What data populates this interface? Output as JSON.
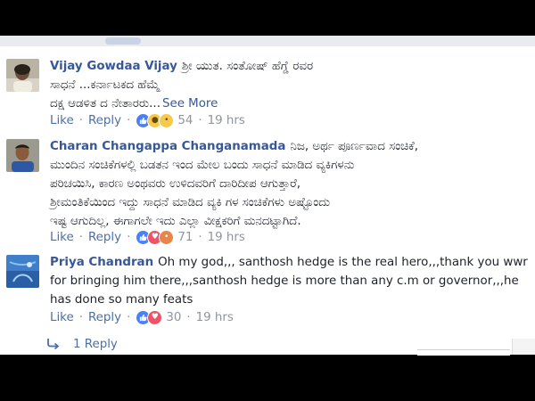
{
  "comments": [
    {
      "author": "Vijay Gowdaa Vijay",
      "text_lines": [
        "ಶ್ರೀ ಯುತ. ಸಂತೋಷ್ ಹೆಗ್ಡೆ ರವರ",
        "ಸಾಧನೆ ...ಕರ್ನಾಟಕದ ಹೆಮ್ಮೆ",
        "ದಕ್ಷ ಆಡಳಿತ ದ ನೇತಾರರು..."
      ],
      "see_more": "See More",
      "like_label": "Like",
      "reply_label": "Reply",
      "reactions": [
        "like",
        "wow",
        "sad"
      ],
      "reaction_count": "54",
      "time": "19 hrs"
    },
    {
      "author": "Charan Changappa Changanamada",
      "text_lines": [
        "ನಿಜ, ಅರ್ಥ ಪೂರ್ಣವಾದ ಸಂಚಿಕೆ,",
        "ಮುಂದಿನ ಸಂಚಿಕೆಗಳಲ್ಲಿ ಬಡತನ ಇಂದ ಮೇಲ ಬಂದು ಸಾಧನೆ ಮಾಡಿದ ವ್ಯಕಿಗಳನು",
        "ಪರಿಚಯಿಸಿ, ಕಾರಣ ಅಂಥವರು ಉಳಿದವರಿಗೆ ದಾರಿದೀಪ ಆಗುತ್ತಾರೆ,",
        "ಶ್ರೀಮಂತಿಕೆಯಿಂದ ಇದ್ದು ಸಾಧನೆ ಮಾಡಿದ ವ್ಯಕಿ ಗಳ ಸಂಚಿಕೆಗಳು ಅಷ್ಟೊಂದು",
        "ಇಷ್ಟ ಆಗುದಿಲ್ಲ, ಈಗಾಗಲೇ ಇದು ಎಲ್ಲಾ ವೀಕ್ಷಕರಿಗೆ ಮನದಟ್ಟಾಗಿದೆ."
      ],
      "like_label": "Like",
      "reply_label": "Reply",
      "reactions": [
        "like",
        "love",
        "angry"
      ],
      "reaction_count": "71",
      "time": "19 hrs"
    },
    {
      "author": "Priya Chandran",
      "text_lines": [
        "Oh my god,,, santhosh hedge is the real hero,,,thank you wwr",
        "for bringing him there,,,santhosh hedge is more than any c.m or governor,,,he",
        "has done so many feats"
      ],
      "like_label": "Like",
      "reply_label": "Reply",
      "reactions": [
        "like",
        "love"
      ],
      "reaction_count": "30",
      "time": "19 hrs"
    }
  ],
  "replies_link": "1 Reply",
  "colors": {
    "link_blue": "#365899",
    "action_blue": "#4b6fa8",
    "meta_gray": "#90949c",
    "body_text": "#1d2129"
  },
  "icons": {
    "reply_arrow": "reply-arrow-icon",
    "like": "like-reaction-icon",
    "love": "love-reaction-icon",
    "wow": "wow-reaction-icon",
    "sad": "sad-reaction-icon",
    "angry": "angry-reaction-icon"
  }
}
